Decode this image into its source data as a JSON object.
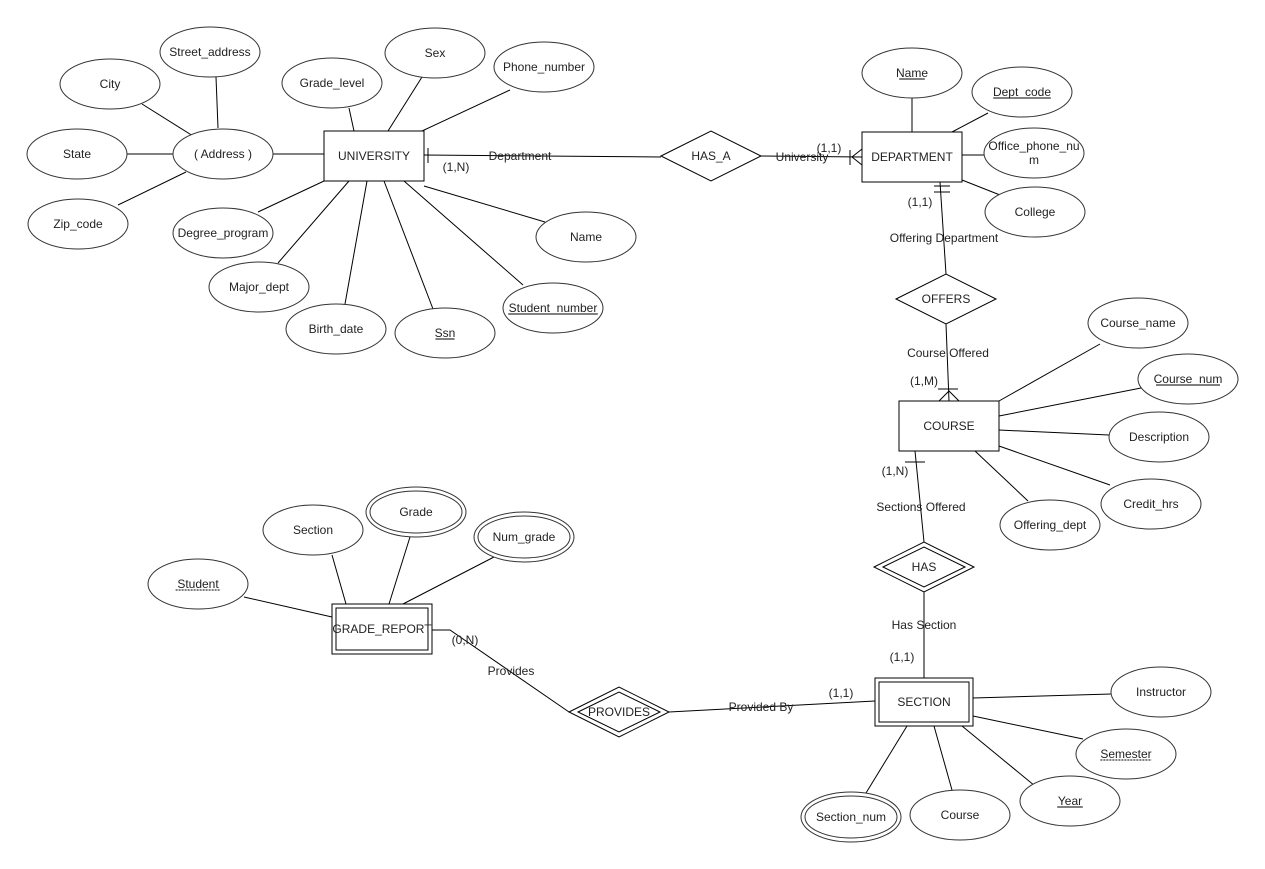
{
  "diagram": {
    "entities": [
      {
        "id": "university",
        "label": "UNIVERSITY",
        "weak": false
      },
      {
        "id": "department",
        "label": "DEPARTMENT",
        "weak": false
      },
      {
        "id": "course",
        "label": "COURSE",
        "weak": false
      },
      {
        "id": "section",
        "label": "SECTION",
        "weak": true
      },
      {
        "id": "grade_report",
        "label": "GRADE_REPORT",
        "weak": true
      }
    ],
    "relationships": [
      {
        "id": "has_a",
        "label": "HAS_A",
        "identifying": false
      },
      {
        "id": "offers",
        "label": "OFFERS",
        "identifying": false
      },
      {
        "id": "has",
        "label": "HAS",
        "identifying": true
      },
      {
        "id": "provides",
        "label": "PROVIDES",
        "identifying": true
      }
    ],
    "attributes": [
      {
        "id": "street_address",
        "label": "Street_address",
        "owner": "address",
        "key": "none",
        "multivalued": false
      },
      {
        "id": "city",
        "label": "City",
        "owner": "address",
        "key": "none",
        "multivalued": false
      },
      {
        "id": "state",
        "label": "State",
        "owner": "address",
        "key": "none",
        "multivalued": false
      },
      {
        "id": "zip_code",
        "label": "Zip_code",
        "owner": "address",
        "key": "none",
        "multivalued": false
      },
      {
        "id": "address",
        "label": "( Address )",
        "owner": "university",
        "key": "none",
        "multivalued": false
      },
      {
        "id": "grade_level",
        "label": "Grade_level",
        "owner": "university",
        "key": "none",
        "multivalued": false
      },
      {
        "id": "sex",
        "label": "Sex",
        "owner": "university",
        "key": "none",
        "multivalued": false
      },
      {
        "id": "phone_number",
        "label": "Phone_number",
        "owner": "university",
        "key": "none",
        "multivalued": false
      },
      {
        "id": "degree_program",
        "label": "Degree_program",
        "owner": "university",
        "key": "none",
        "multivalued": false
      },
      {
        "id": "major_dept",
        "label": "Major_dept",
        "owner": "university",
        "key": "none",
        "multivalued": false
      },
      {
        "id": "birth_date",
        "label": "Birth_date",
        "owner": "university",
        "key": "none",
        "multivalued": false
      },
      {
        "id": "ssn",
        "label": "Ssn",
        "owner": "university",
        "key": "key",
        "multivalued": false
      },
      {
        "id": "student_number",
        "label": "Student_number",
        "owner": "university",
        "key": "key",
        "multivalued": false
      },
      {
        "id": "uni_name",
        "label": "Name",
        "owner": "university",
        "key": "none",
        "multivalued": false
      },
      {
        "id": "dept_name",
        "label": "Name",
        "owner": "department",
        "key": "key",
        "multivalued": false
      },
      {
        "id": "dept_code",
        "label": "Dept_code",
        "owner": "department",
        "key": "key",
        "multivalued": false
      },
      {
        "id": "office_phone",
        "label": "Office_phone_nu m",
        "owner": "department",
        "key": "none",
        "multivalued": false
      },
      {
        "id": "college",
        "label": "College",
        "owner": "department",
        "key": "none",
        "multivalued": false
      },
      {
        "id": "course_name",
        "label": "Course_name",
        "owner": "course",
        "key": "none",
        "multivalued": false
      },
      {
        "id": "course_num",
        "label": "Course_num",
        "owner": "course",
        "key": "key",
        "multivalued": false
      },
      {
        "id": "description",
        "label": "Description",
        "owner": "course",
        "key": "none",
        "multivalued": false
      },
      {
        "id": "credit_hrs",
        "label": "Credit_hrs",
        "owner": "course",
        "key": "none",
        "multivalued": false
      },
      {
        "id": "offering_dept",
        "label": "Offering_dept",
        "owner": "course",
        "key": "none",
        "multivalued": false
      },
      {
        "id": "instructor",
        "label": "Instructor",
        "owner": "section",
        "key": "none",
        "multivalued": false
      },
      {
        "id": "semester",
        "label": "Semester",
        "owner": "section",
        "key": "partial",
        "multivalued": false
      },
      {
        "id": "year",
        "label": "Year",
        "owner": "section",
        "key": "key",
        "multivalued": false
      },
      {
        "id": "sec_course",
        "label": "Course",
        "owner": "section",
        "key": "none",
        "multivalued": false
      },
      {
        "id": "section_num",
        "label": "Section_num",
        "owner": "section",
        "key": "none",
        "multivalued": true
      },
      {
        "id": "student",
        "label": "Student",
        "owner": "grade_report",
        "key": "partial",
        "multivalued": false
      },
      {
        "id": "gr_section",
        "label": "Section",
        "owner": "grade_report",
        "key": "none",
        "multivalued": false
      },
      {
        "id": "grade",
        "label": "Grade",
        "owner": "grade_report",
        "key": "none",
        "multivalued": true
      },
      {
        "id": "num_grade",
        "label": "Num_grade",
        "owner": "grade_report",
        "key": "none",
        "multivalued": true
      }
    ],
    "links": [
      {
        "id": "uni_hasa",
        "role": "Department",
        "cardinality": "(1,N)"
      },
      {
        "id": "hasa_dept",
        "role": "University",
        "cardinality": "(1,1)"
      },
      {
        "id": "dept_offers",
        "role": "Offering Department",
        "cardinality": "(1,1)"
      },
      {
        "id": "offers_course",
        "role": "Course Offered",
        "cardinality": "(1,M)"
      },
      {
        "id": "course_has",
        "role": "Sections Offered",
        "cardinality": "(1,N)"
      },
      {
        "id": "has_section",
        "role": "Has Section",
        "cardinality": "(1,1)"
      },
      {
        "id": "section_provides",
        "role": "Provided By",
        "cardinality": "(1,1)"
      },
      {
        "id": "provides_gr",
        "role": "Provides",
        "cardinality": "(0,N)"
      }
    ]
  }
}
